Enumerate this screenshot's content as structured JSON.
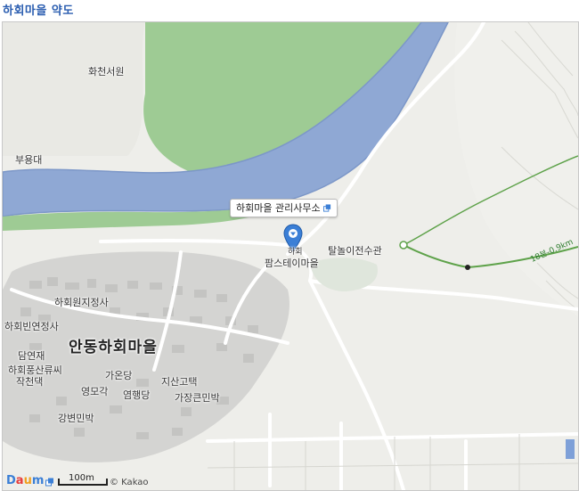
{
  "title": "하회마을 약도",
  "map": {
    "callout_label": "하회마을 관리사무소",
    "marker_label_top": "하회",
    "marker_label": "팜스테이마을",
    "place_labels": {
      "hwacheon": "화천서원",
      "buyongdae": "부용대",
      "talnori": "탈놀이전수관",
      "village_main": "안동하회마을",
      "hahoewon": "하회원지정사",
      "hahoebin": "하회빈연정사",
      "damyeonjae": "담연재",
      "hahoepung": "하회풍산류씨",
      "jakcheon": "작천댁",
      "gaondang": "가온당",
      "jisan": "지산고택",
      "yeongmogak": "영모각",
      "yeomhaengdang": "염행당",
      "gajang": "가장큰민박",
      "gangbyeon": "강변민박"
    },
    "trail_label": "18분-0.9km",
    "scale_label": "100m",
    "copyright": "© Kakao",
    "logo": "Daum",
    "colors": {
      "river": "#8fa8d4",
      "river_edge": "#7c97c8",
      "grass": "#9ecb94",
      "land": "#eeeeea",
      "village": "#d4d4d2",
      "road": "#ffffff",
      "trail": "#5ea24a",
      "marker": "#3b7fd6",
      "title": "#2a5db0"
    }
  }
}
